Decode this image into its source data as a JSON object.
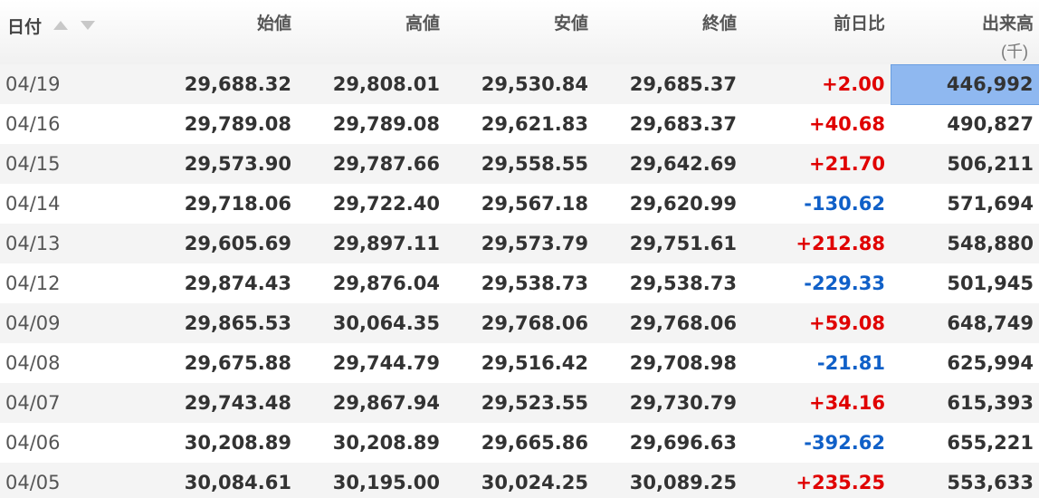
{
  "colors": {
    "positive": "#e00000",
    "negative": "#1060c8",
    "highlight": "#8fb8f0"
  },
  "header": {
    "date": "日付",
    "open": "始値",
    "high": "高値",
    "low": "安値",
    "close": "終値",
    "change": "前日比",
    "volume": "出来高",
    "volume_unit": "(千)",
    "sort_asc_icon": "sort-ascending-icon",
    "sort_desc_icon": "sort-descending-icon"
  },
  "rows": [
    {
      "date": "04/19",
      "open": "29,688.32",
      "high": "29,808.01",
      "low": "29,530.84",
      "close": "29,685.37",
      "change": "+2.00",
      "direction": "up",
      "volume": "446,992",
      "selected": true
    },
    {
      "date": "04/16",
      "open": "29,789.08",
      "high": "29,789.08",
      "low": "29,621.83",
      "close": "29,683.37",
      "change": "+40.68",
      "direction": "up",
      "volume": "490,827",
      "selected": false
    },
    {
      "date": "04/15",
      "open": "29,573.90",
      "high": "29,787.66",
      "low": "29,558.55",
      "close": "29,642.69",
      "change": "+21.70",
      "direction": "up",
      "volume": "506,211",
      "selected": false
    },
    {
      "date": "04/14",
      "open": "29,718.06",
      "high": "29,722.40",
      "low": "29,567.18",
      "close": "29,620.99",
      "change": "-130.62",
      "direction": "down",
      "volume": "571,694",
      "selected": false
    },
    {
      "date": "04/13",
      "open": "29,605.69",
      "high": "29,897.11",
      "low": "29,573.79",
      "close": "29,751.61",
      "change": "+212.88",
      "direction": "up",
      "volume": "548,880",
      "selected": false
    },
    {
      "date": "04/12",
      "open": "29,874.43",
      "high": "29,876.04",
      "low": "29,538.73",
      "close": "29,538.73",
      "change": "-229.33",
      "direction": "down",
      "volume": "501,945",
      "selected": false
    },
    {
      "date": "04/09",
      "open": "29,865.53",
      "high": "30,064.35",
      "low": "29,768.06",
      "close": "29,768.06",
      "change": "+59.08",
      "direction": "up",
      "volume": "648,749",
      "selected": false
    },
    {
      "date": "04/08",
      "open": "29,675.88",
      "high": "29,744.79",
      "low": "29,516.42",
      "close": "29,708.98",
      "change": "-21.81",
      "direction": "down",
      "volume": "625,994",
      "selected": false
    },
    {
      "date": "04/07",
      "open": "29,743.48",
      "high": "29,867.94",
      "low": "29,523.55",
      "close": "29,730.79",
      "change": "+34.16",
      "direction": "up",
      "volume": "615,393",
      "selected": false
    },
    {
      "date": "04/06",
      "open": "30,208.89",
      "high": "30,208.89",
      "low": "29,665.86",
      "close": "29,696.63",
      "change": "-392.62",
      "direction": "down",
      "volume": "655,221",
      "selected": false
    },
    {
      "date": "04/05",
      "open": "30,084.61",
      "high": "30,195.00",
      "low": "30,024.25",
      "close": "30,089.25",
      "change": "+235.25",
      "direction": "up",
      "volume": "553,633",
      "selected": false
    }
  ]
}
